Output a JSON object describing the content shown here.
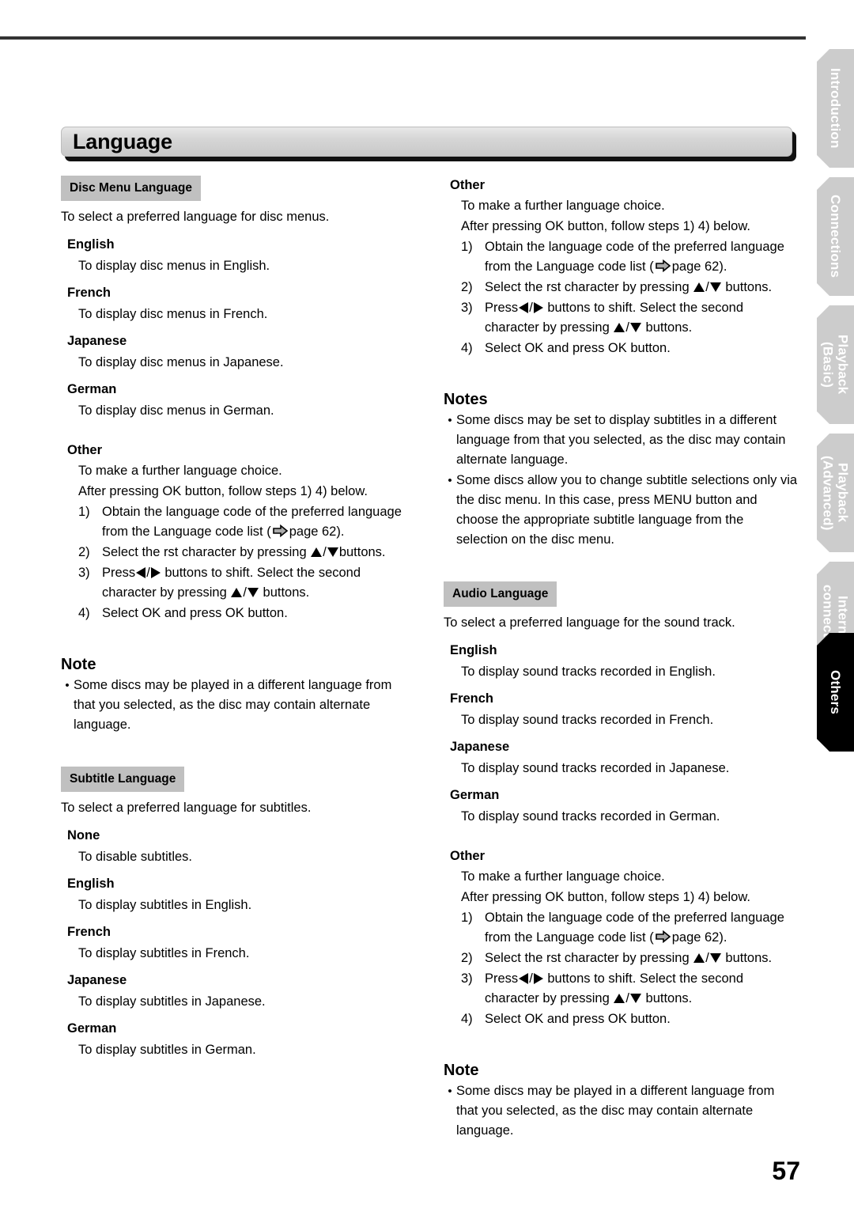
{
  "page": {
    "title": "Language",
    "number": "57"
  },
  "side_tabs": [
    {
      "label": "Introduction",
      "active": false
    },
    {
      "label": "Connections",
      "active": false
    },
    {
      "label": "Playback\n(Basic)",
      "active": false
    },
    {
      "label": "Playback\n(Advanced)",
      "active": false
    },
    {
      "label": "Internet\nconnection",
      "active": false
    },
    {
      "label": "Others",
      "active": true
    }
  ],
  "icons": {
    "page_arrow": "right-arrow-icon",
    "up": "triangle-up-icon",
    "down": "triangle-down-icon",
    "left": "triangle-left-icon",
    "right": "triangle-right-icon"
  },
  "steps_common": {
    "intro_1": "To make a further language choice.",
    "intro_2": "After pressing OK button, follow steps 1)  4) below.",
    "s1_num": "1)",
    "s1_a": "Obtain the language code of the preferred language",
    "s1_b_pre": "from the Language code list (",
    "s1_b_post": "page 62).",
    "s2_num": "2)",
    "s2_pre": "Select the  rst character by pressing",
    "s2_mid": "/",
    "s2_post": "buttons.",
    "s3_num": "3)",
    "s3_pre": "Press",
    "s3_mid": "/",
    "s3_post": "buttons to shift. Select the second",
    "s3_b_pre": "character by pressing",
    "s3_b_mid": "/",
    "s3_b_post": "buttons.",
    "s4_num": "4)",
    "s4": "Select  OK  and press OK button."
  },
  "disc_menu_language": {
    "badge": "Disc Menu Language",
    "lead": "To select a preferred language for disc menus.",
    "options": [
      {
        "name": "English",
        "desc": "To display disc menus in English."
      },
      {
        "name": "French",
        "desc": "To display disc menus in French."
      },
      {
        "name": "Japanese",
        "desc": "To display disc menus in Japanese."
      },
      {
        "name": "German",
        "desc": "To display disc menus in German."
      }
    ],
    "other_name": "Other"
  },
  "disc_menu_note": {
    "heading": "Note",
    "bullets": [
      "Some discs may be played in a different language from that you selected, as the disc may contain alternate language."
    ]
  },
  "subtitle_language": {
    "badge": "Subtitle Language",
    "lead": "To select a preferred language for subtitles.",
    "options": [
      {
        "name": "None",
        "desc": "To disable subtitles."
      },
      {
        "name": "English",
        "desc": "To display subtitles in English."
      },
      {
        "name": "French",
        "desc": "To display subtitles in French."
      },
      {
        "name": "Japanese",
        "desc": "To display subtitles in Japanese."
      },
      {
        "name": "German",
        "desc": "To display subtitles in German."
      }
    ],
    "other_name": "Other"
  },
  "subtitle_notes": {
    "heading": "Notes",
    "bullets": [
      "Some discs may be set to display subtitles in a different language from that you selected, as the disc may contain alternate language.",
      "Some discs allow you to change subtitle selections only via the disc menu. In this case, press MENU button and choose the appropriate subtitle language from the selection on the disc menu."
    ]
  },
  "audio_language": {
    "badge": "Audio Language",
    "lead": "To select a preferred language for the sound track.",
    "options": [
      {
        "name": "English",
        "desc": "To display sound tracks recorded in English."
      },
      {
        "name": "French",
        "desc": "To display sound tracks recorded in French."
      },
      {
        "name": "Japanese",
        "desc": "To display sound tracks recorded in Japanese."
      },
      {
        "name": "German",
        "desc": "To display sound tracks recorded in German."
      }
    ],
    "other_name": "Other"
  },
  "audio_note": {
    "heading": "Note",
    "bullets": [
      "Some discs may be played in a different language from that you selected, as the disc may contain alternate language."
    ]
  },
  "bullet_char": "•",
  "colors": {
    "badge_bg": "#c0c0c0",
    "tab_inactive": "#cccccc",
    "tab_active": "#000000",
    "rule": "#333333",
    "arrow_fill": "#aaaaaa"
  }
}
